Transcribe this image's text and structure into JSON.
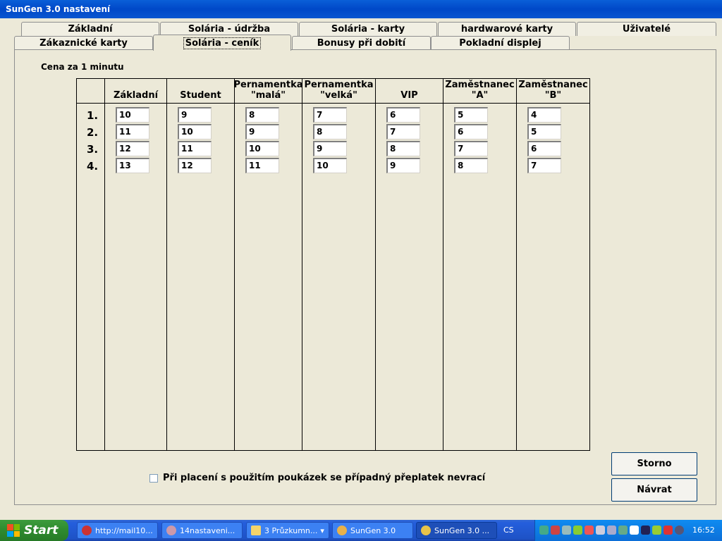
{
  "window": {
    "title": "SunGen 3.0 nastavení"
  },
  "tabs_row1": [
    "Základní",
    "Solária - údržba",
    "Solária - karty",
    "hardwarové karty",
    "Uživatelé"
  ],
  "tabs_row2": [
    "Zákaznické karty",
    "Solária - ceník",
    "Bonusy při dobití",
    "Pokladní displej"
  ],
  "active_tab": "Solária - ceník",
  "section_label": "Cena za 1 minutu",
  "columns": [
    {
      "l1": "",
      "l2": "Základní"
    },
    {
      "l1": "",
      "l2": "Student"
    },
    {
      "l1": "Pernamentka",
      "l2": "\"malá\""
    },
    {
      "l1": "Pernamentka",
      "l2": "\"velká\""
    },
    {
      "l1": "",
      "l2": "VIP"
    },
    {
      "l1": "Zaměstnanec",
      "l2": "\"A\""
    },
    {
      "l1": "Zaměstnanec",
      "l2": "\"B\""
    }
  ],
  "row_labels": [
    "1.",
    "2.",
    "3.",
    "4."
  ],
  "prices": [
    [
      "10",
      "9",
      "8",
      "7",
      "6",
      "5",
      "4"
    ],
    [
      "11",
      "10",
      "9",
      "8",
      "7",
      "6",
      "5"
    ],
    [
      "12",
      "11",
      "10",
      "9",
      "8",
      "7",
      "6"
    ],
    [
      "13",
      "12",
      "11",
      "10",
      "9",
      "8",
      "7"
    ]
  ],
  "checkbox": {
    "label": "Při placení s použitím poukázek se případný přeplatek nevrací",
    "checked": false
  },
  "buttons": {
    "cancel": "Storno",
    "return": "Návrat"
  },
  "taskbar": {
    "start": "Start",
    "tasks": [
      "http://mail10...",
      "14nastaveni...",
      "3 Průzkumn...",
      "SunGen 3.0",
      "SunGen 3.0 ..."
    ],
    "language": "CS",
    "clock": "16:52"
  }
}
